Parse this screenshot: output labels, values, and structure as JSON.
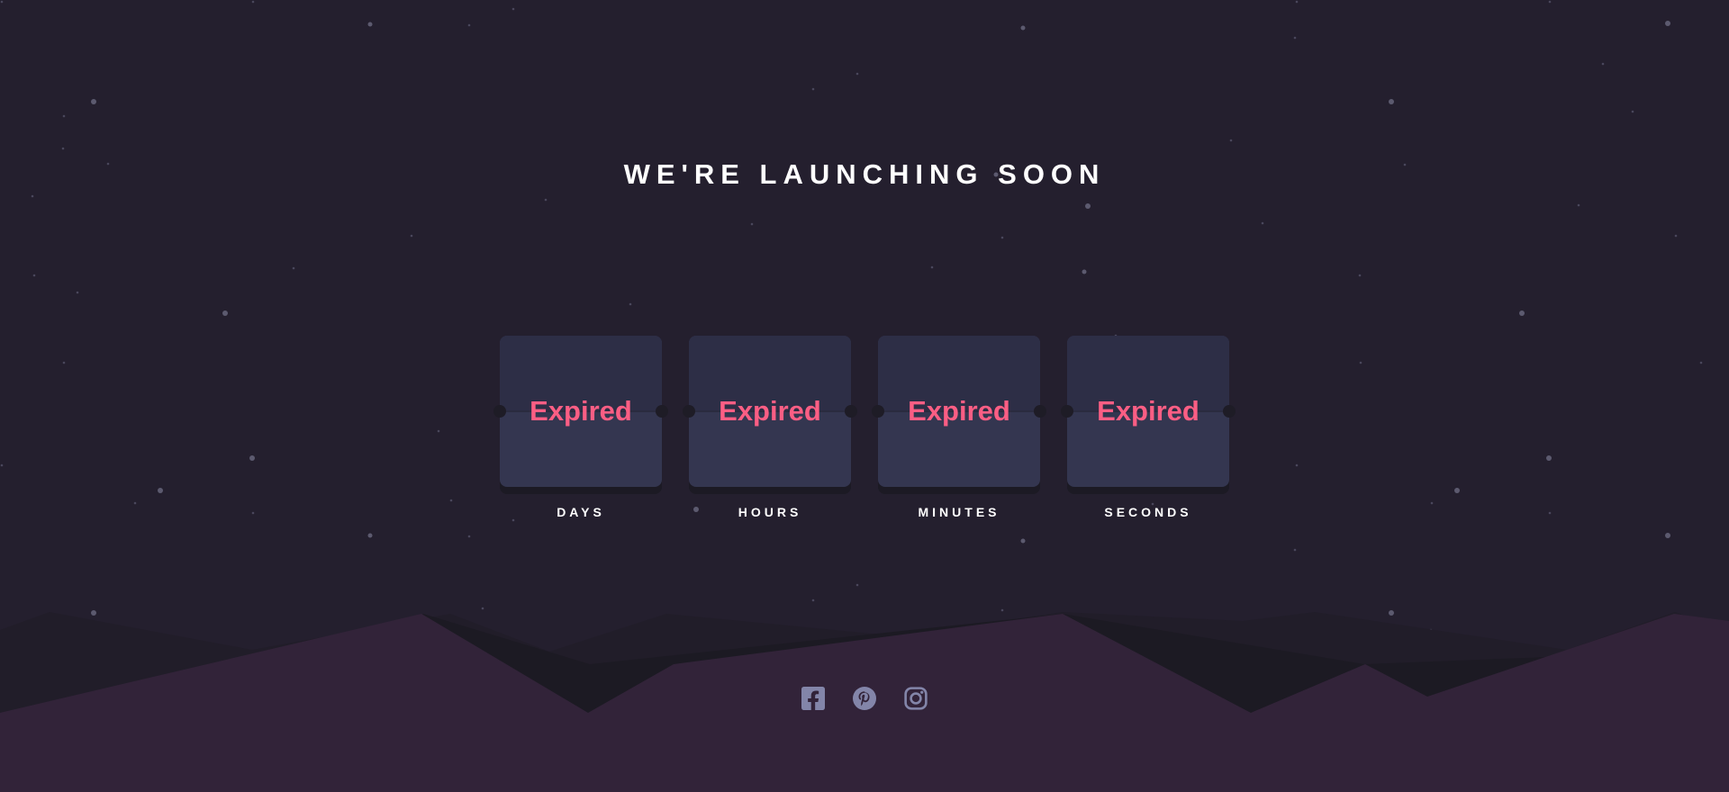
{
  "headline": "WE'RE LAUNCHING SOON",
  "countdown": [
    {
      "value": "Expired",
      "label": "DAYS"
    },
    {
      "value": "Expired",
      "label": "HOURS"
    },
    {
      "value": "Expired",
      "label": "MINUTES"
    },
    {
      "value": "Expired",
      "label": "SECONDS"
    }
  ],
  "social": [
    {
      "icon": "facebook-icon"
    },
    {
      "icon": "pinterest-icon"
    },
    {
      "icon": "instagram-icon"
    }
  ],
  "colors": {
    "background": "#241f2e",
    "card": "#343650",
    "card_top": "#2d2e46",
    "accent": "#fb5e84",
    "hills": "#322339",
    "icon": "#8385a9",
    "text": "#ffffff"
  }
}
